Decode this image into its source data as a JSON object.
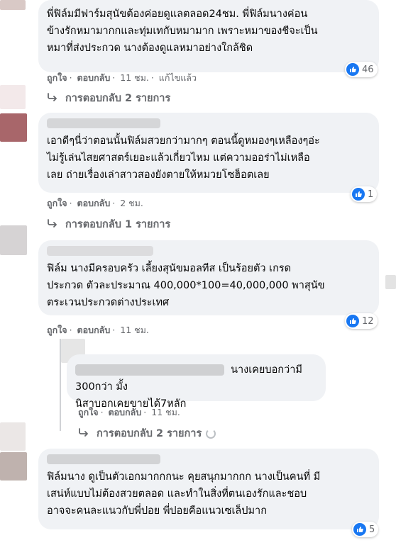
{
  "comments": [
    {
      "lines": [
        "พี่ฟิล์มมีฟาร์มสุนัขต้องค่อยดูแลตลอด24ชม. พี่ฟิล์มนางค่อน",
        "ข้างรักหมามากกและทุ่มเทกับหมามาก เพราะหมาของชีจะเป็น",
        "หมาที่ส่งประกวด นางต้องดูแลหมาอย่างใกล้ชิด"
      ],
      "like": "ถูกใจ",
      "reply": "ตอบกลับ",
      "time": "11 ชม.",
      "edited": "แก้ไขแล้ว",
      "reactions": "46",
      "replies_link": "การตอบกลับ 2 รายการ"
    },
    {
      "lines": [
        "เอาดีๆนี่ว่าตอนนั้นฟิล์มสวยกว่ามากๆ ตอนนี้ดูหมองๆเหลืองๆอ่ะ",
        "ไม่รู้เล่นไสยศาสตร์เยอะแล้วเกี่ยวไหม แต่ความออร่าไม่เหลือ",
        "เลย ถ่ายเรื่องเล่าสาวสองยังตายให้หมวยโซฮ็อตเลย"
      ],
      "like": "ถูกใจ",
      "reply": "ตอบกลับ",
      "time": "2 ชม.",
      "reactions": "1",
      "replies_link": "การตอบกลับ 1 รายการ"
    },
    {
      "lines": [
        "ฟิล์ม นางมีครอบครัว เลี้ยงสุนัขมอลทีส เป็นร้อยตัว เกรด",
        "ประกวด ตัวละประมาณ 400,000*100=40,000,000 พาสุนัข",
        "ตระเวนประกวดต่างประเทศ"
      ],
      "like": "ถูกใจ",
      "reply": "ตอบกลับ",
      "time": "11 ชม.",
      "reactions": "12"
    },
    {
      "lines": [
        "นางเคยบอกว่ามี 300กว่า มั้ง",
        "นิสาบอกเคยขายได้7หลัก"
      ],
      "like": "ถูกใจ",
      "reply": "ตอบกลับ",
      "time": "11 ชม.",
      "replies_link": "การตอบกลับ 2 รายการ"
    },
    {
      "lines": [
        "ฟิล์มนาง ดูเป็นตัวเอกมากกกนะ คุยสนุกมากกก นางเป็นคนที่ มี",
        "เสน่ห์แบบไม่ต้องสวยตลอด และทำในสิ่งที่ตนเองรักและชอบ",
        "อาจจะคนละแนวกับพี่ปอย พี่ปอยคือแนวเซเล็ปมาก"
      ],
      "reactions": "5"
    }
  ],
  "colors": {
    "bubble": "#f0f2f5",
    "meta": "#65676b",
    "like_blue": "#1877f2"
  }
}
